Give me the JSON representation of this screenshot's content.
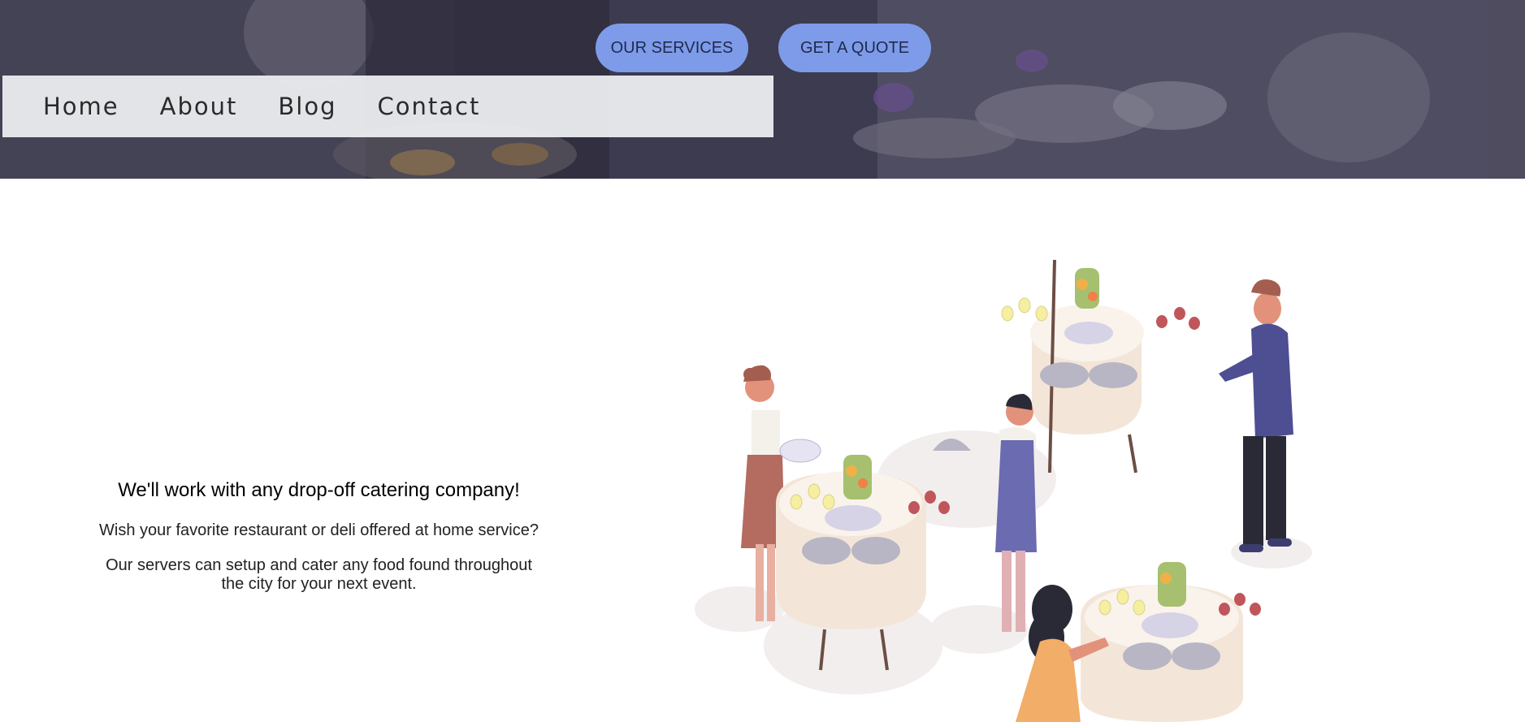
{
  "hero": {
    "buttons": {
      "services": "OUR SERVICES",
      "quote": "GET A QUOTE"
    }
  },
  "nav": {
    "items": [
      "Home",
      "About",
      "Blog",
      "Contact"
    ]
  },
  "content": {
    "title": "We'll work with any drop-off catering company!",
    "paragraph1": "Wish your favorite restaurant or deli offered at home service?",
    "paragraph2": "Our servers can setup and cater any food found throughout the city for your next event."
  },
  "colors": {
    "button_bg": "#7e9bea",
    "hero_overlay": "#3b3a4e",
    "nav_bg": "#ecedf0"
  },
  "illustration": "catering-event-illustration"
}
